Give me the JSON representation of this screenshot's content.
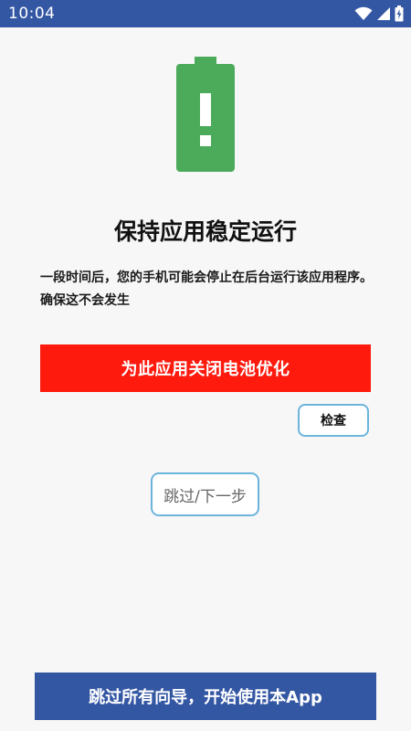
{
  "status_bar": {
    "time": "10:04",
    "icons": [
      "wifi-icon",
      "signal-icon",
      "battery-charging-icon"
    ]
  },
  "hero": {
    "icon": "battery-alert-icon",
    "color": "#4caa5b"
  },
  "content": {
    "title": "保持应用稳定运行",
    "description": "一段时间后，您的手机可能会停止在后台运行该应用程序。确保这不会发生"
  },
  "actions": {
    "disable_battery_optimization": "为此应用关闭电池优化",
    "check": "检查",
    "skip_next": "跳过/下一步",
    "skip_all": "跳过所有向导，开始使用本App"
  },
  "colors": {
    "status_bar": "#3457a4",
    "primary_red": "#ff1a0e",
    "primary_blue": "#3457a4",
    "outline_blue": "#6db4dc",
    "background": "#f7f7f7"
  }
}
